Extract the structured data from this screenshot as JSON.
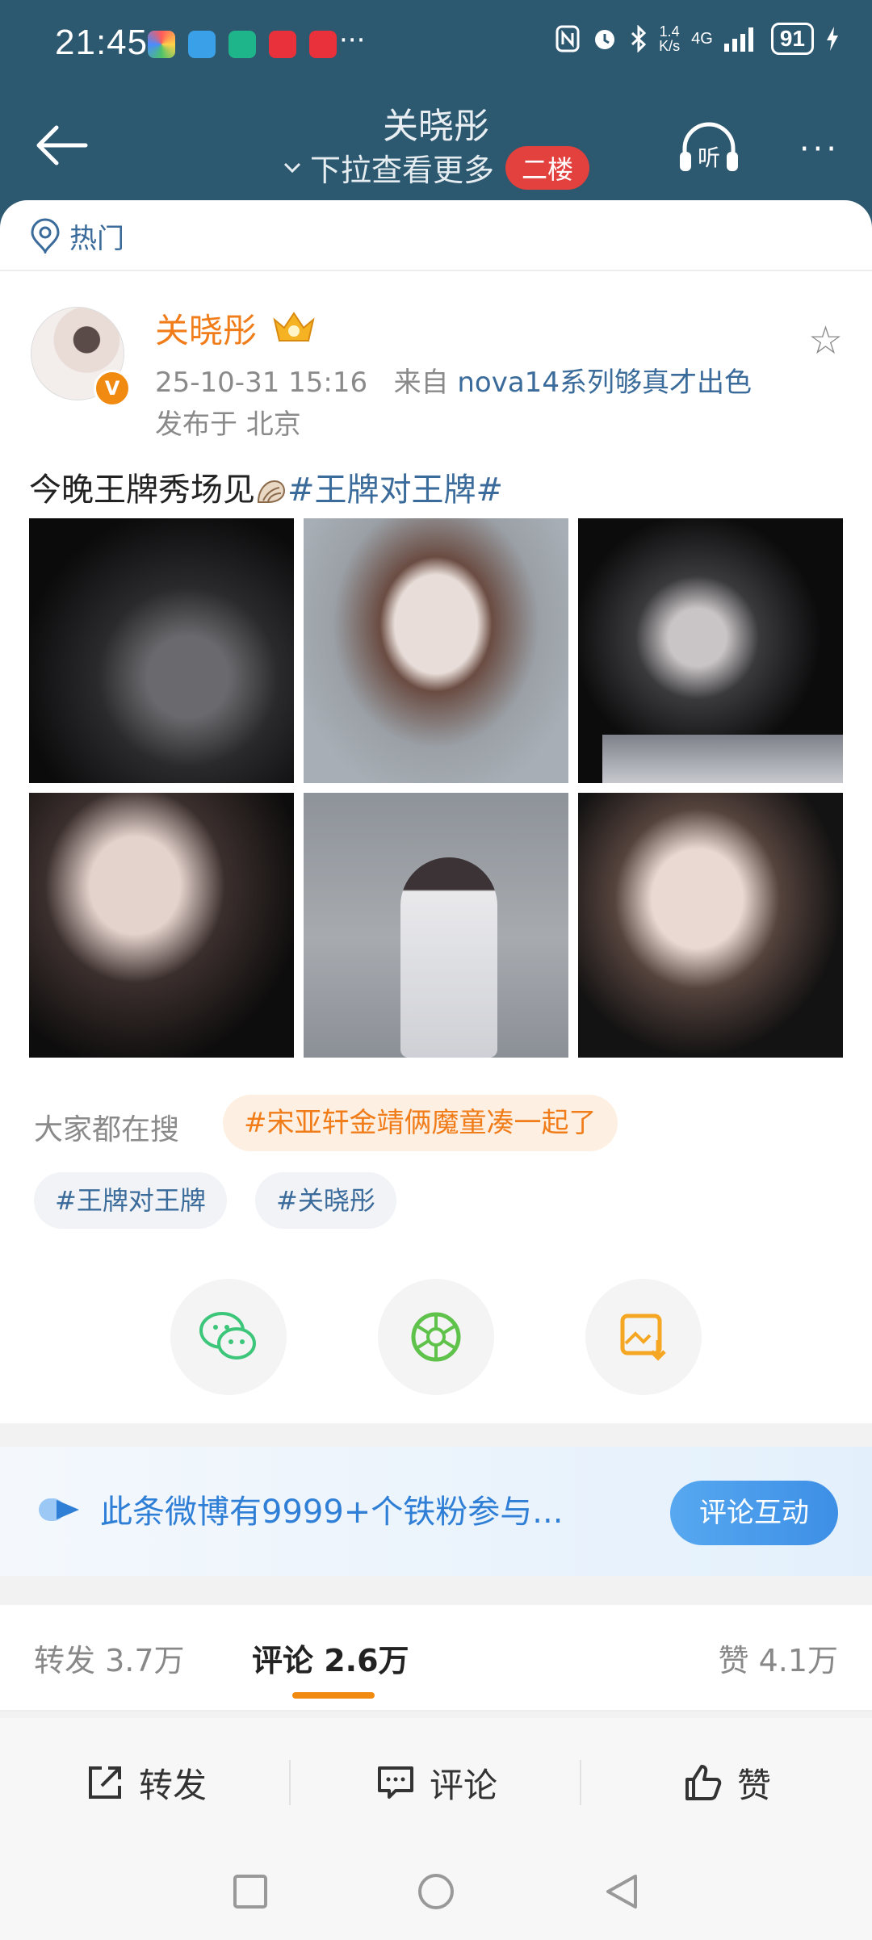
{
  "status_bar": {
    "time": "21:45",
    "overflow": "···",
    "net_speed_top": "1.4",
    "net_speed_bottom": "K/s",
    "signal": "4G",
    "battery": "91"
  },
  "nav": {
    "title": "关晓彤",
    "subtitle": "下拉查看更多",
    "floor_badge": "二楼",
    "listen_label": "听",
    "more": "···"
  },
  "hot_label": "热门",
  "post": {
    "author": "关晓彤",
    "timestamp": "25-10-31 15:16",
    "from_prefix": "来自",
    "source": "nova14系列够真才出色",
    "location": "发布于 北京",
    "text": "今晚王牌秀场见",
    "hashtag": "#王牌对王牌#",
    "verified_badge": "V",
    "photo_count": 6
  },
  "trending": {
    "label": "大家都在搜",
    "hot_query": "#宋亚轩金靖俩魔童凑一起了",
    "tags": [
      "#王牌对王牌",
      "#关晓彤"
    ]
  },
  "share_icons": [
    "wechat-icon",
    "moments-icon",
    "save-image-icon"
  ],
  "banner": {
    "text": "此条微博有9999+个铁粉参与...",
    "button": "评论互动"
  },
  "stats": {
    "reposts": "转发 3.7万",
    "comments": "评论 2.6万",
    "likes": "赞 4.1万"
  },
  "actions": {
    "repost": "转发",
    "comment": "评论",
    "like": "赞"
  },
  "colors": {
    "header_bg": "#2c5870",
    "accent_orange": "#f07c1a",
    "link_blue": "#3a6b9a",
    "floor_red": "#e2413e"
  }
}
